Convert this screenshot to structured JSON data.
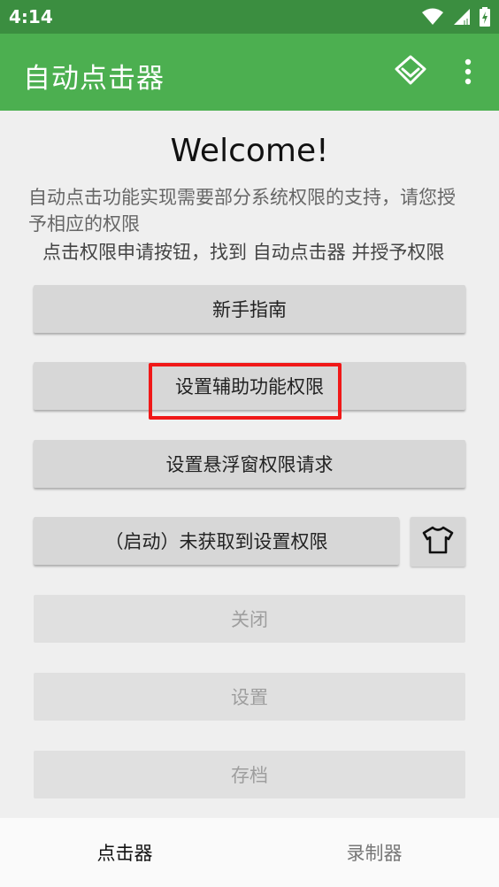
{
  "status_bar": {
    "time": "4:14",
    "icons": [
      "wifi-icon",
      "signal-icon",
      "battery-icon"
    ]
  },
  "app_bar": {
    "title": "自动点击器",
    "actions": [
      "diamond-icon",
      "more-vert-icon"
    ]
  },
  "main": {
    "welcome": "Welcome!",
    "description": "自动点击功能实现需要部分系统权限的支持，请您授予相应的权限",
    "hint": "点击权限申请按钮，找到 自动点击器 并授予权限",
    "buttons": {
      "guide": "新手指南",
      "accessibility": "设置辅助功能权限",
      "overlay": "设置悬浮窗权限请求",
      "start": "（启动）未获取到设置权限",
      "close": "关闭",
      "settings": "设置",
      "save": "存档"
    },
    "shirt_icon": "tshirt-icon"
  },
  "bottom_nav": {
    "tabs": [
      {
        "label": "点击器",
        "active": true
      },
      {
        "label": "录制器",
        "active": false
      }
    ]
  },
  "colors": {
    "status_bar": "#3b8e40",
    "app_bar": "#4caf50",
    "highlight": "#f01818"
  }
}
